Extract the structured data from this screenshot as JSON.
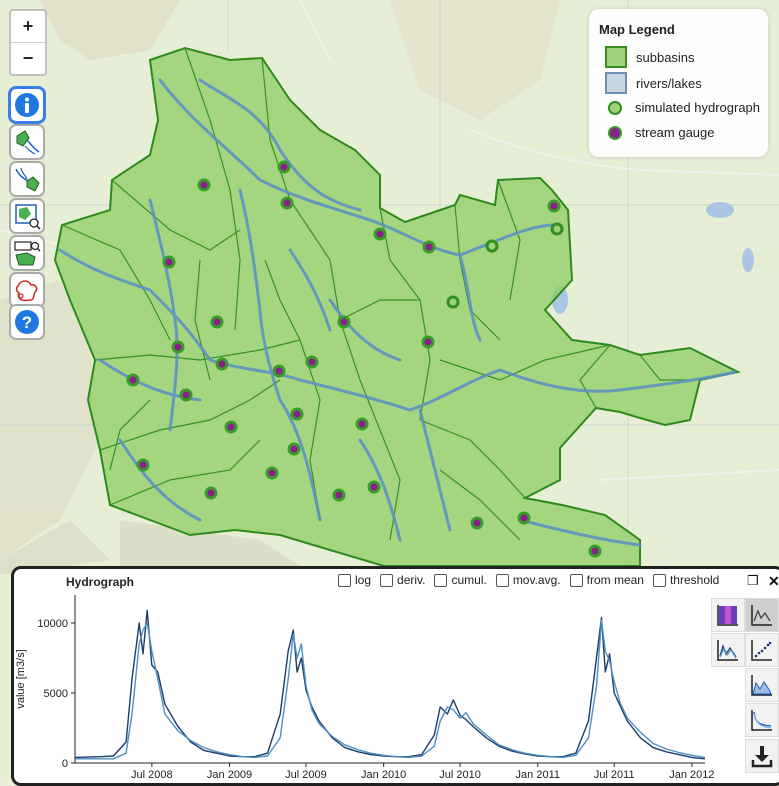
{
  "map": {
    "zoom_in": "+",
    "zoom_out": "−",
    "tools": [
      "info-icon",
      "subbasin-select-icon",
      "river-select-icon",
      "zoom-subbasin-icon",
      "zoom-extent-icon",
      "draw-outline-icon",
      "help-icon"
    ],
    "legend": {
      "title": "Map Legend",
      "items": [
        {
          "label": "subbasins",
          "symbol": "subbasin-swatch"
        },
        {
          "label": "rivers/lakes",
          "symbol": "river-swatch"
        },
        {
          "label": "simulated hydrograph",
          "symbol": "simulated-marker"
        },
        {
          "label": "stream gauge",
          "symbol": "gauge-marker"
        }
      ]
    },
    "colors": {
      "land": "#e9efd9",
      "subbasin_fill": "#8fcf67",
      "subbasin_stroke": "#2f8a1e",
      "river": "#5b8fc7",
      "gauge": "#8b1f8c"
    }
  },
  "hydrograph": {
    "title": "Hydrograph",
    "options": [
      "log",
      "deriv.",
      "cumul.",
      "mov.avg.",
      "from mean",
      "threshold"
    ],
    "maximize": "❐",
    "close": "✕",
    "side_buttons": [
      "color-plot-icon",
      "line-plot-icon",
      "hydrograph-icon",
      "scatter-plot-icon",
      "area-plot-icon",
      "exceedance-icon",
      "download-icon"
    ]
  },
  "chart_data": {
    "type": "line",
    "title": "",
    "xlabel": "",
    "ylabel": "value [m3/s]",
    "ylim": [
      0,
      12000
    ],
    "y_ticks": [
      0,
      5000,
      10000
    ],
    "x_ticks": [
      "Jul 2008",
      "Jan 2009",
      "Jul 2009",
      "Jan 2010",
      "Jul 2010",
      "Jan 2011",
      "Jul 2011",
      "Jan 2012"
    ],
    "x_range": [
      "2008-01",
      "2012-02"
    ],
    "grid": false,
    "series": [
      {
        "color": "#1e3c6a",
        "x": [
          "2008-01",
          "2008-03",
          "2008-04",
          "2008-05",
          "2008-05-15",
          "2008-06",
          "2008-06-10",
          "2008-06-20",
          "2008-07",
          "2008-07-15",
          "2008-08",
          "2008-09",
          "2008-10",
          "2008-11",
          "2008-12",
          "2009-01",
          "2009-02",
          "2009-03",
          "2009-04",
          "2009-05",
          "2009-05-20",
          "2009-06",
          "2009-06-10",
          "2009-06-20",
          "2009-07",
          "2009-07-15",
          "2009-08",
          "2009-09",
          "2009-10",
          "2009-11",
          "2009-12",
          "2010-01",
          "2010-02",
          "2010-03",
          "2010-04",
          "2010-05",
          "2010-05-15",
          "2010-06",
          "2010-06-15",
          "2010-07",
          "2010-07-15",
          "2010-08",
          "2010-09",
          "2010-10",
          "2010-11",
          "2010-12",
          "2011-01",
          "2011-02",
          "2011-03",
          "2011-04",
          "2011-05",
          "2011-05-20",
          "2011-06",
          "2011-06-10",
          "2011-06-20",
          "2011-07",
          "2011-07-15",
          "2011-08",
          "2011-09",
          "2011-10",
          "2011-11",
          "2011-12",
          "2012-01",
          "2012-02"
        ],
        "y": [
          400,
          450,
          500,
          1500,
          6000,
          10000,
          7800,
          10900,
          7000,
          6500,
          4200,
          2600,
          1500,
          900,
          700,
          500,
          450,
          450,
          700,
          3500,
          8000,
          9500,
          6500,
          7500,
          5200,
          4000,
          3000,
          1800,
          1100,
          800,
          600,
          500,
          450,
          450,
          600,
          2000,
          4000,
          3500,
          4500,
          3400,
          3100,
          2600,
          1800,
          1200,
          850,
          650,
          500,
          450,
          450,
          700,
          3000,
          7500,
          10400,
          6500,
          7800,
          5000,
          4100,
          3000,
          1800,
          1100,
          800,
          600,
          400,
          300
        ]
      },
      {
        "color": "#4f8fc5",
        "x": [
          "2008-01",
          "2008-03",
          "2008-04",
          "2008-05",
          "2008-05-15",
          "2008-06",
          "2008-06-10",
          "2008-06-20",
          "2008-07",
          "2008-07-15",
          "2008-08",
          "2008-09",
          "2008-10",
          "2008-11",
          "2008-12",
          "2009-01",
          "2009-02",
          "2009-03",
          "2009-04",
          "2009-05",
          "2009-05-20",
          "2009-06",
          "2009-06-10",
          "2009-06-20",
          "2009-07",
          "2009-07-15",
          "2009-08",
          "2009-09",
          "2009-10",
          "2009-11",
          "2009-12",
          "2010-01",
          "2010-02",
          "2010-03",
          "2010-04",
          "2010-05",
          "2010-05-15",
          "2010-06",
          "2010-06-15",
          "2010-07",
          "2010-07-15",
          "2010-08",
          "2010-09",
          "2010-10",
          "2010-11",
          "2010-12",
          "2011-01",
          "2011-02",
          "2011-03",
          "2011-04",
          "2011-05",
          "2011-05-20",
          "2011-06",
          "2011-06-10",
          "2011-06-20",
          "2011-07",
          "2011-07-15",
          "2011-08",
          "2011-09",
          "2011-10",
          "2011-11",
          "2011-12",
          "2012-01",
          "2012-02"
        ],
        "y": [
          300,
          300,
          300,
          700,
          3500,
          8500,
          9500,
          10000,
          8000,
          6000,
          3500,
          2300,
          1600,
          1100,
          800,
          600,
          450,
          400,
          500,
          1800,
          6000,
          9200,
          7500,
          8500,
          5500,
          3800,
          2800,
          1900,
          1300,
          950,
          700,
          550,
          450,
          400,
          500,
          1200,
          3000,
          4000,
          3800,
          3200,
          3600,
          2800,
          2000,
          1300,
          950,
          700,
          550,
          450,
          400,
          550,
          1800,
          5500,
          10200,
          8000,
          7300,
          5800,
          4300,
          3200,
          2200,
          1400,
          1000,
          750,
          550,
          400
        ]
      }
    ]
  }
}
